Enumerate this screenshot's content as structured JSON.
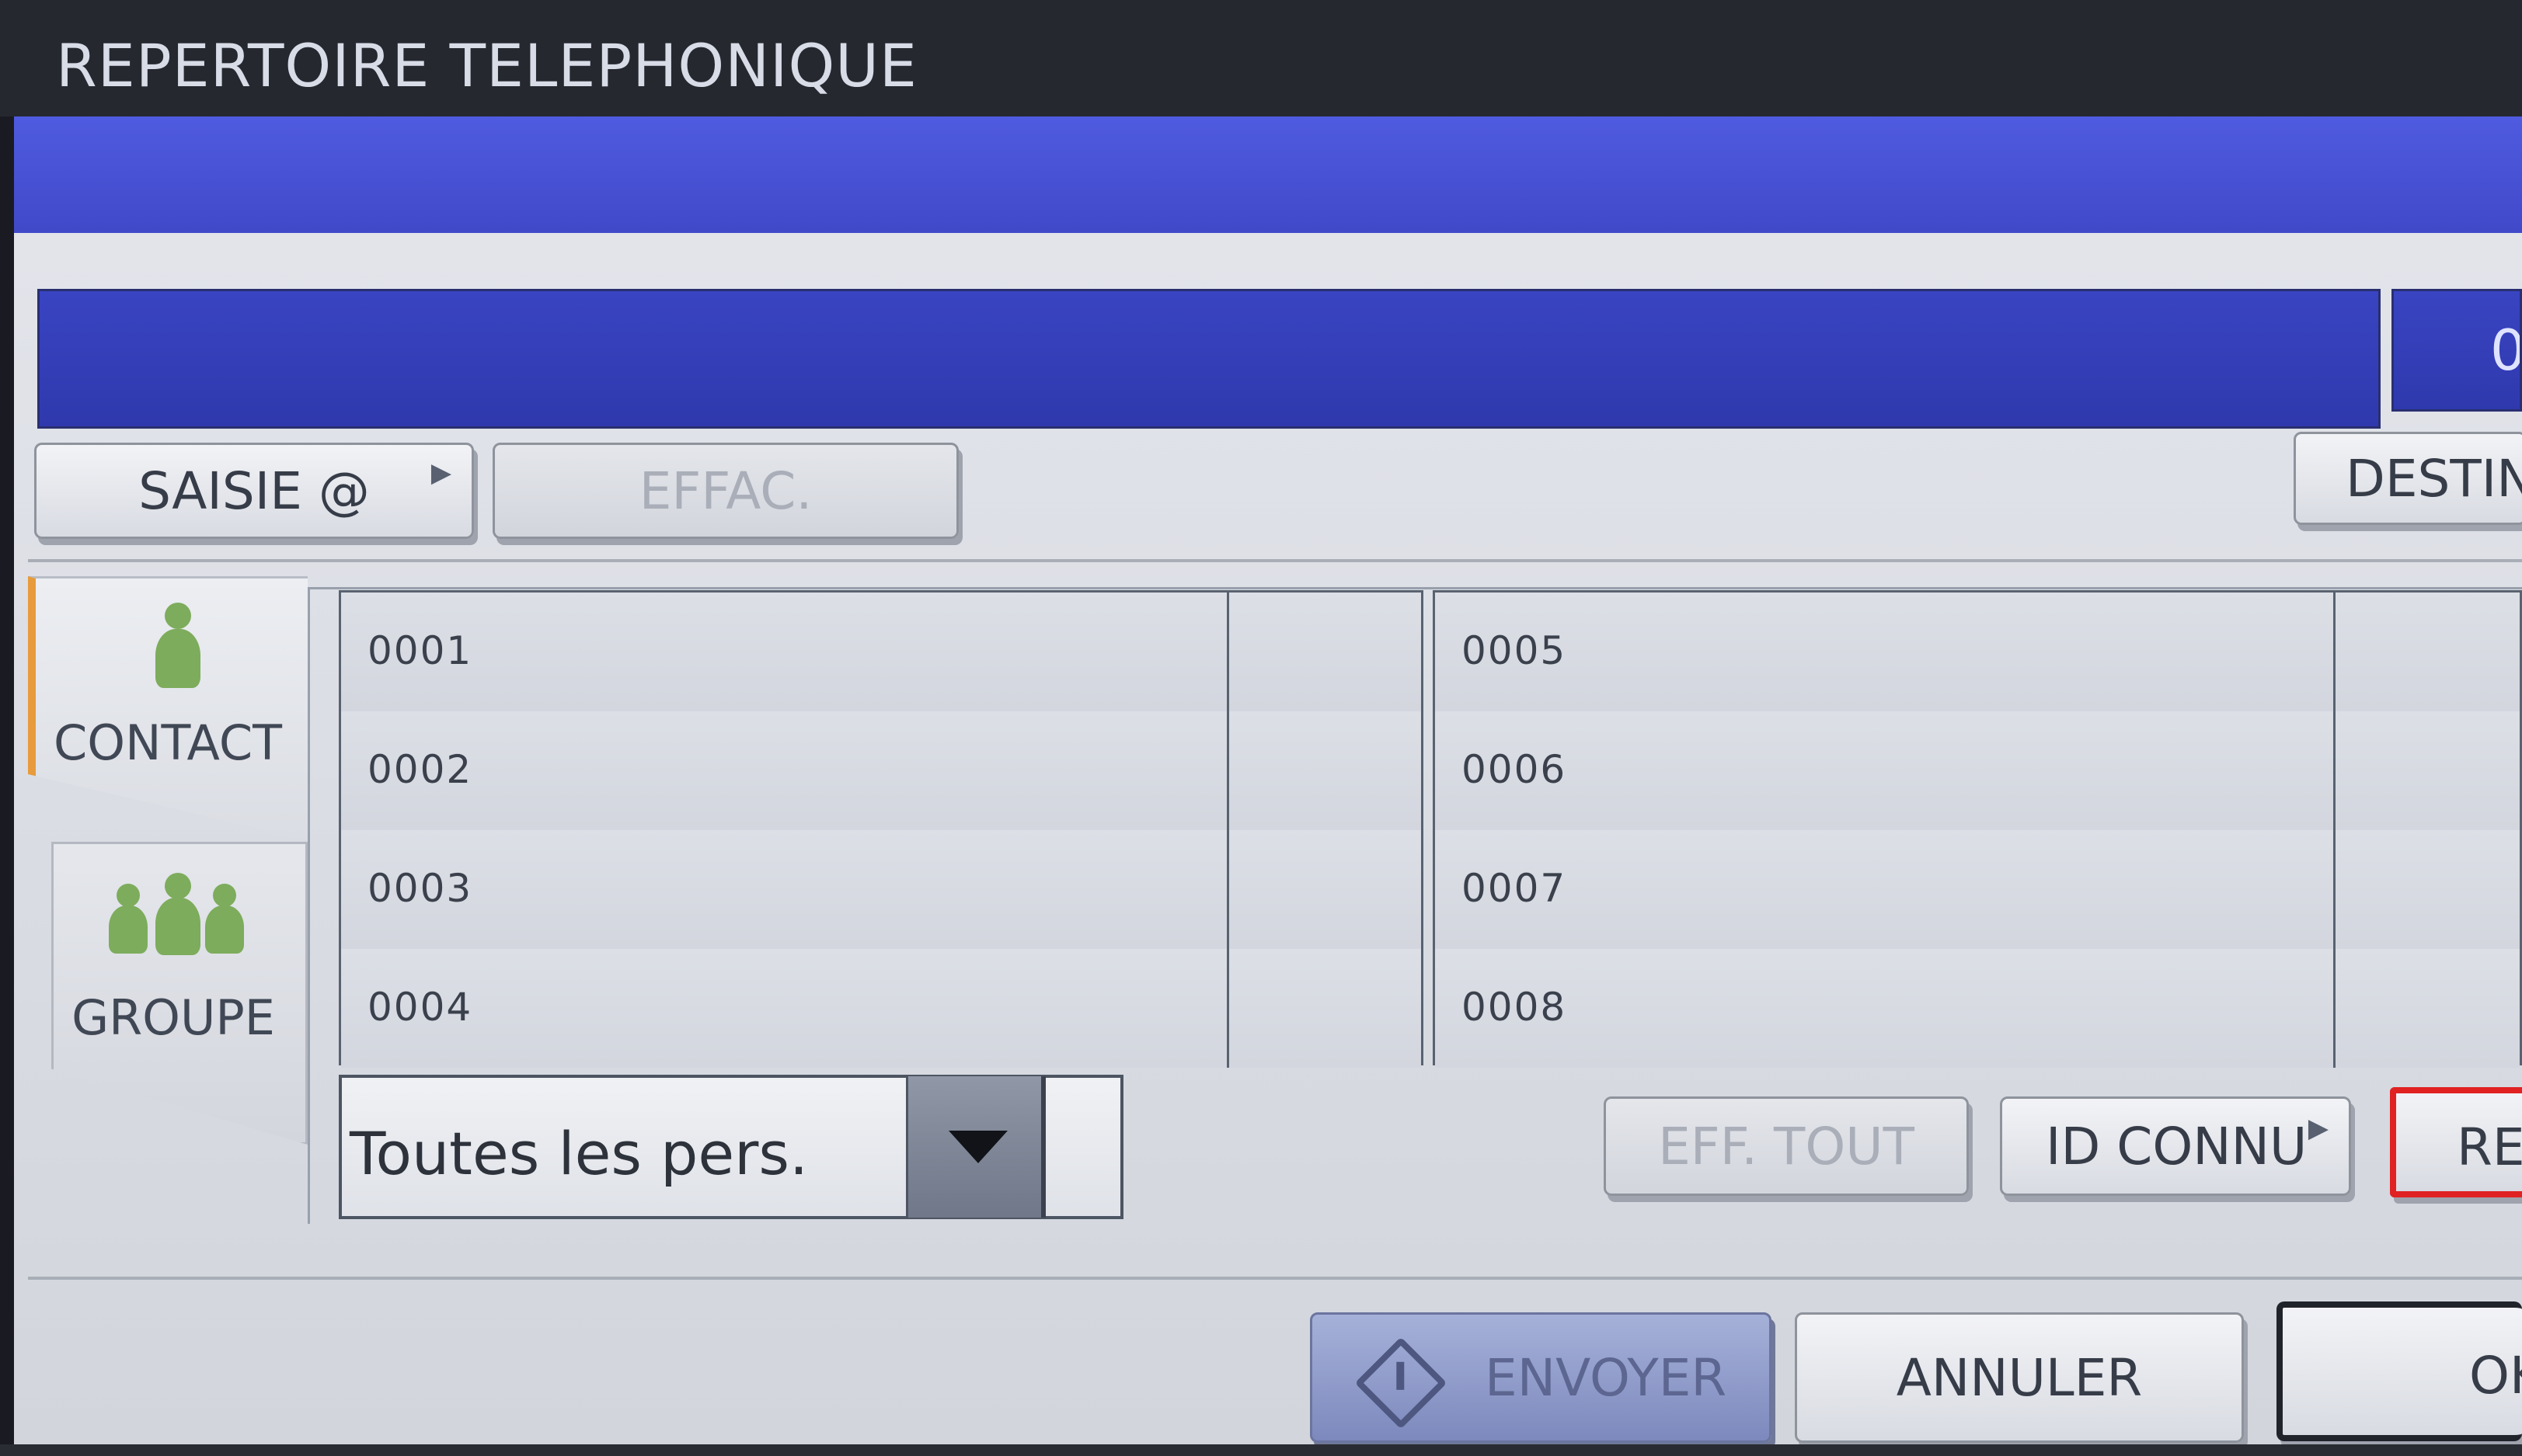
{
  "window": {
    "title": "REPERTOIRE TELEPHONIQUE"
  },
  "destination": {
    "count": "0"
  },
  "toolbar": {
    "saisie_label": "SAISIE @",
    "effac_label": "EFFAC.",
    "destina_label": "DESTINA"
  },
  "tabs": {
    "contact_label": "CONTACT",
    "groupe_label": "GROUPE"
  },
  "entries": {
    "left": [
      "0001",
      "0002",
      "0003",
      "0004"
    ],
    "right": [
      "0005",
      "0006",
      "0007",
      "0008"
    ]
  },
  "filter": {
    "selected": "Toutes les pers."
  },
  "actions": {
    "eff_tout_label": "EFF. TOUT",
    "id_connu_label": "ID CONNU",
    "re_label": "RE"
  },
  "footer": {
    "envoyer_label": "ENVOYER",
    "annuler_label": "ANNULER",
    "ok_label": "OK"
  },
  "icons": {
    "contact": "person-icon",
    "groupe": "group-icon",
    "envoyer": "send-diamond-icon",
    "filter": "dropdown-arrow-icon"
  },
  "colors": {
    "banner_blue": "#4049c8",
    "tab_accent": "#e79b3c",
    "icon_green": "#7dac5c",
    "highlight_red": "#e02222"
  }
}
